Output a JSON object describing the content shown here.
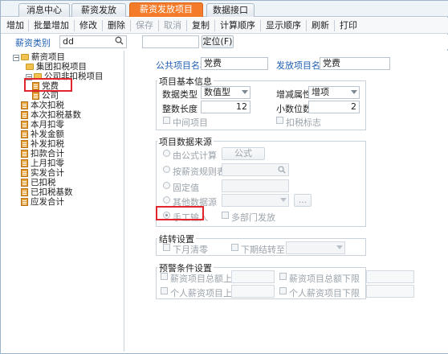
{
  "tabs": [
    {
      "label": "消息中心",
      "active": false
    },
    {
      "label": "薪资发放",
      "active": false
    },
    {
      "label": "薪资发放项目",
      "active": true
    },
    {
      "label": "数据接口",
      "active": false
    }
  ],
  "toolbar": {
    "add": "增加",
    "batch_add": "批量增加",
    "edit": "修改",
    "delete": "删除",
    "save": "保存",
    "cancel": "取消",
    "copy": "复制",
    "calc_order": "计算顺序",
    "display_order": "显示顺序",
    "refresh": "刷新",
    "print": "打印"
  },
  "search": {
    "category_label": "薪资类别",
    "category_value": "dd",
    "locate_value": "",
    "locate_button": "定位(F)"
  },
  "tree": {
    "root": "薪资项目",
    "items": [
      "集团扣税项目",
      "公司非扣税项目",
      "党费",
      "公司",
      "本次扣税",
      "本次扣税基数",
      "本月扣零",
      "补发金额",
      "补发扣税",
      "扣款合计",
      "上月扣零",
      "实发合计",
      "已扣税",
      "已扣税基数",
      "应发合计"
    ]
  },
  "form": {
    "public_name_label": "公共项目名称",
    "public_name_value": "党费",
    "release_name_label": "发放项目名称",
    "release_name_value": "党费",
    "basic_info": {
      "title": "项目基本信息",
      "data_type_label": "数据类型",
      "data_type_value": "数值型",
      "inc_dec_label": "增减属性",
      "inc_dec_value": "增项",
      "int_length_label": "整数长度",
      "int_length_value": "12",
      "decimals_label": "小数位数",
      "decimals_value": "2",
      "intermediate_label": "中间项目",
      "tax_flag_label": "扣税标志"
    },
    "source": {
      "title": "项目数据来源",
      "formula_label": "由公式计算",
      "formula_button": "公式",
      "rule_table_label": "按薪资规则表",
      "fixed_label": "固定值",
      "other_label": "其他数据源",
      "more_button": "...",
      "manual_label": "手工输入",
      "multi_dept_label": "多部门发放"
    },
    "carry": {
      "title": "结转设置",
      "this_month_zero_label": "下月清零",
      "next_period_label": "下期结转至"
    },
    "warning": {
      "title": "预警条件设置",
      "total_upper_label": "薪资项目总额上限",
      "total_lower_label": "薪资项目总额下限",
      "personal_upper_label": "个人薪资项目上限",
      "personal_lower_label": "个人薪资项目下限"
    }
  },
  "colors": {
    "active_tab": "#f47b2a",
    "link_blue": "#1f5fb4",
    "highlight_red": "#e3262b"
  }
}
